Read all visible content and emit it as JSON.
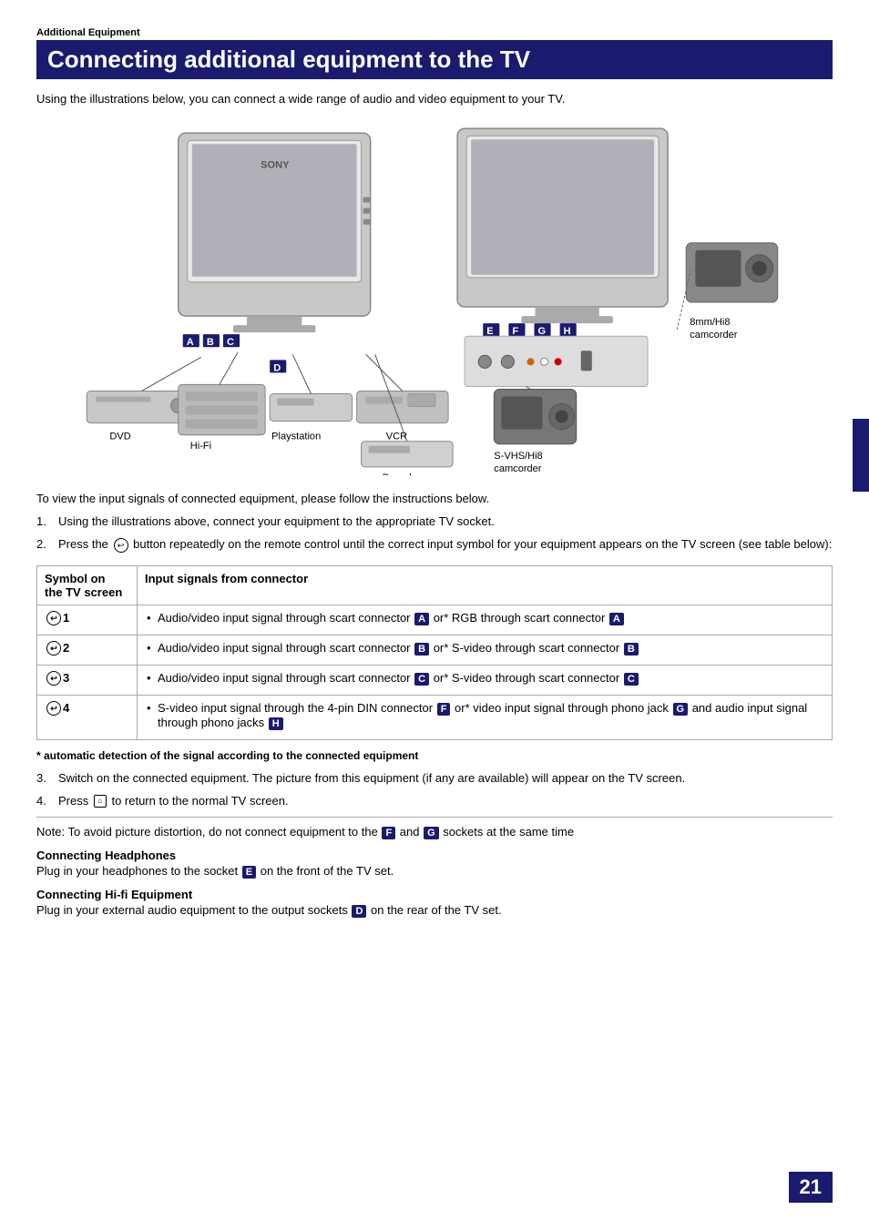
{
  "section_label": "Additional Equipment",
  "page_title": "Connecting additional equipment to the TV",
  "intro_text": "Using the illustrations below, you can connect a wide range of audio and video equipment to your TV.",
  "view_instructions": "To view the input signals of connected equipment, please follow the instructions below.",
  "steps": [
    {
      "num": "1.",
      "text": "Using the illustrations above, connect your equipment to the appropriate TV socket."
    },
    {
      "num": "2.",
      "text": "Press the  button repeatedly on the remote control until the correct input symbol for your equipment appears on the TV screen (see table below):"
    },
    {
      "num": "3.",
      "text": "Switch on the connected equipment. The picture from this equipment (if any are available) will appear on the TV screen."
    },
    {
      "num": "4.",
      "text": "Press   to return to the normal TV screen."
    }
  ],
  "table": {
    "header_symbol": "Symbol on\nthe TV screen",
    "header_signals": "Input signals from connector",
    "rows": [
      {
        "symbol": "⇦1",
        "signals": [
          "Audio/video input signal through scart connector A or* RGB through scart connector A"
        ]
      },
      {
        "symbol": "⇦2",
        "signals": [
          "Audio/video input signal through scart connector B or* S-video through scart connector B"
        ]
      },
      {
        "symbol": "⇦3",
        "signals": [
          "Audio/video input signal through scart connector C or* S-video through scart connector C"
        ]
      },
      {
        "symbol": "⇦4",
        "signals": [
          "S-video input signal through the 4-pin DIN connector F or* video input signal through phono jack G and audio input signal through phono jacks H"
        ]
      }
    ]
  },
  "asterisk_note": "* automatic detection of the signal according to the connected equipment",
  "bottom_note": "Note: To avoid picture distortion, do not connect equipment to the F and G sockets at the same time",
  "connecting_headphones_heading": "Connecting Headphones",
  "connecting_headphones_text": "Plug in your headphones to the socket E on the front of the TV set.",
  "connecting_hifi_heading": "Connecting Hi-fi Equipment",
  "connecting_hifi_text": "Plug in your external audio equipment to the output sockets D on the rear of the TV set.",
  "page_number": "21",
  "equipment_labels": {
    "dvd": "DVD",
    "hifi": "Hi-Fi",
    "playstation": "Playstation",
    "vcr": "VCR",
    "decoder": "Decoder",
    "camcorder_8mm": "8mm/Hi8\ncamcorder",
    "svhs": "S-VHS/Hi8\ncamcorder"
  },
  "connectors": {
    "A": "A",
    "B": "B",
    "C": "C",
    "D": "D",
    "E": "E",
    "F": "F",
    "G": "G",
    "H": "H"
  }
}
